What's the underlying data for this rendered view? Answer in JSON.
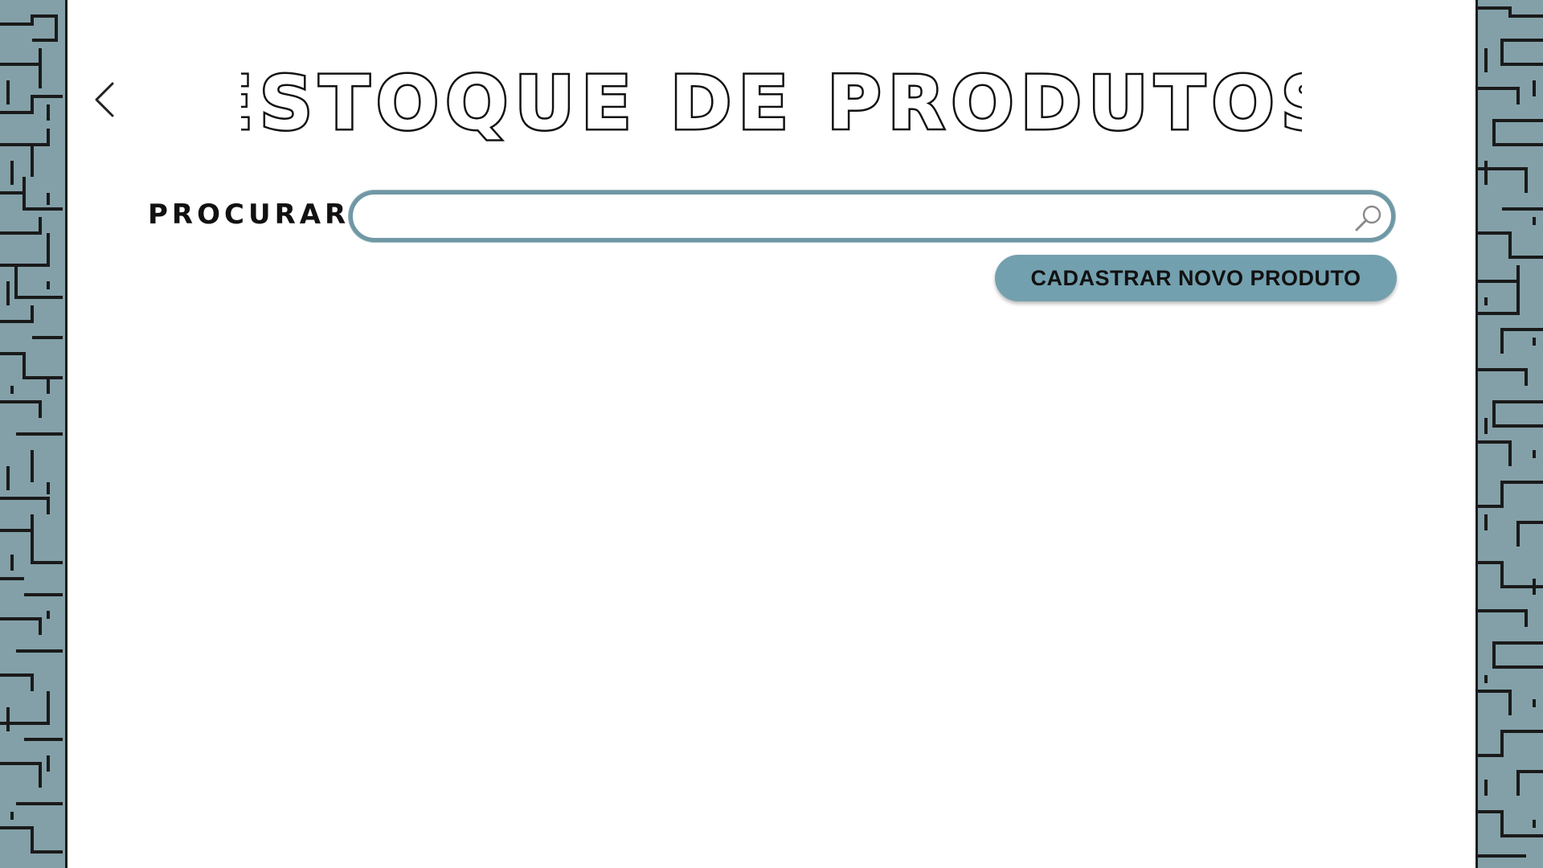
{
  "colors": {
    "border_pattern_fill": "#83a0a8",
    "border_pattern_line": "#1a1a1a",
    "accent": "#73a0ae",
    "search_outline": "#6f98a5"
  },
  "header": {
    "back_icon": "chevron-left-icon",
    "title": "ESTOQUE DE PRODUTOS"
  },
  "search": {
    "label": "PROCURAR:",
    "value": "",
    "placeholder": "",
    "icon": "search-icon"
  },
  "actions": {
    "add_product_label": "CADASTRAR NOVO PRODUTO"
  }
}
